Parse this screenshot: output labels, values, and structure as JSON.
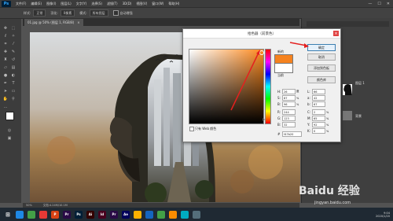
{
  "menubar": {
    "logo": "Ps",
    "items": [
      "文件(F)",
      "编辑(E)",
      "图像(I)",
      "图层(L)",
      "文字(Y)",
      "选择(S)",
      "滤镜(T)",
      "3D(D)",
      "视图(V)",
      "窗口(W)",
      "帮助(H)"
    ],
    "win_min": "—",
    "win_max": "☐",
    "win_close": "✕"
  },
  "optbar": {
    "style_label": "样式:",
    "style_value": "正常",
    "feather_label": "羽化:",
    "feather_value": "0像素",
    "mode_label": "模式:",
    "mode_value": "所有图层",
    "sample_label": "自动增强"
  },
  "document": {
    "tab_label": "01.jpg @ 50% (图层 1, RGB/8)",
    "tab_close": "×",
    "status_zoom": "50%",
    "status_doc": "文档:4.24M/10.1M"
  },
  "dialog": {
    "title": "拾色器（前景色）",
    "close": "×",
    "new_label": "新的",
    "current_label": "当前",
    "ok": "确定",
    "cancel": "取消",
    "add_swatch": "添加到色板",
    "color_libs": "颜色库",
    "web_only": "只有 Web 颜色",
    "hex_label": "#",
    "hex_value": "f47b20",
    "fields_left": [
      {
        "label": "H:",
        "value": "26",
        "unit": "度"
      },
      {
        "label": "S:",
        "value": "87",
        "unit": "%"
      },
      {
        "label": "B:",
        "value": "96",
        "unit": "%"
      },
      {
        "label": "R:",
        "value": "244",
        "unit": ""
      },
      {
        "label": "G:",
        "value": "123",
        "unit": ""
      },
      {
        "label": "B:",
        "value": "32",
        "unit": ""
      }
    ],
    "fields_right": [
      {
        "label": "L:",
        "value": "66",
        "unit": ""
      },
      {
        "label": "a:",
        "value": "42",
        "unit": ""
      },
      {
        "label": "b:",
        "value": "67",
        "unit": ""
      },
      {
        "label": "C:",
        "value": "2",
        "unit": "%"
      },
      {
        "label": "M:",
        "value": "65",
        "unit": "%"
      },
      {
        "label": "Y:",
        "value": "92",
        "unit": "%"
      },
      {
        "label": "K:",
        "value": "0",
        "unit": "%"
      }
    ]
  },
  "panel": {
    "layer_name": "图层 1",
    "layer2_name": "背景"
  },
  "taskbar": {
    "clock_time": "9:04",
    "clock_date": "2020/1/20",
    "watermark": "Baidu 经验",
    "watermark_url": "jingyan.baidu.com",
    "apps": [
      {
        "label": "",
        "color": "#1e88e5"
      },
      {
        "label": "",
        "color": "#43a047"
      },
      {
        "label": "",
        "color": "#e53935"
      },
      {
        "label": "P",
        "color": "#d84315"
      },
      {
        "label": "Pr",
        "color": "#2a0a46"
      },
      {
        "label": "Ps",
        "color": "#001e36"
      },
      {
        "label": "Ai",
        "color": "#330000"
      },
      {
        "label": "Id",
        "color": "#49021f"
      },
      {
        "label": "Pr",
        "color": "#2a0a46"
      },
      {
        "label": "Ae",
        "color": "#00005b"
      },
      {
        "label": "",
        "color": "#ffb300"
      },
      {
        "label": "",
        "color": "#1565c0"
      },
      {
        "label": "",
        "color": "#43a047"
      },
      {
        "label": "",
        "color": "#fb8c00"
      },
      {
        "label": "",
        "color": "#00acc1"
      },
      {
        "label": "",
        "color": "#546e7a"
      }
    ]
  },
  "colors": {
    "selected": "#f47b20",
    "accent_arrow": "#e4201f"
  }
}
